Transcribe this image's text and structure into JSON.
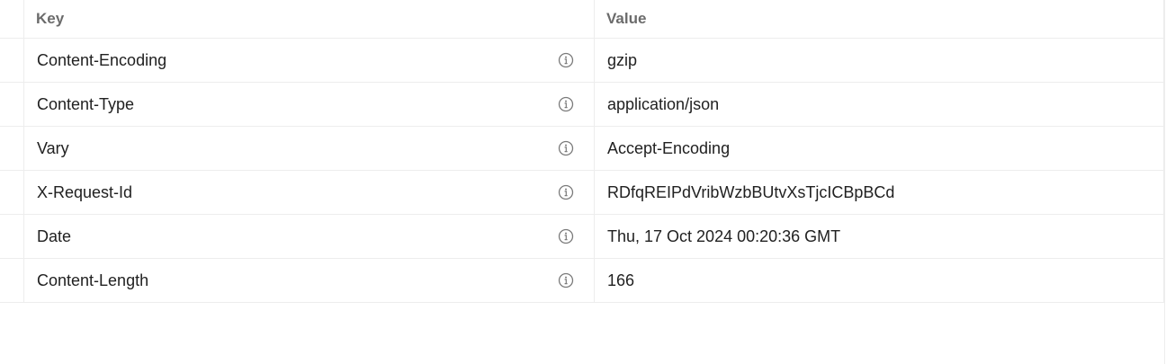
{
  "table": {
    "columns": {
      "key": "Key",
      "value": "Value"
    },
    "rows": [
      {
        "key": "Content-Encoding",
        "value": "gzip"
      },
      {
        "key": "Content-Type",
        "value": "application/json"
      },
      {
        "key": "Vary",
        "value": "Accept-Encoding"
      },
      {
        "key": "X-Request-Id",
        "value": "RDfqREIPdVribWzbBUtvXsTjcICBpBCd"
      },
      {
        "key": "Date",
        "value": "Thu, 17 Oct 2024 00:20:36 GMT"
      },
      {
        "key": "Content-Length",
        "value": "166"
      }
    ]
  },
  "icons": {
    "row_info": "info-circle-icon"
  },
  "colors": {
    "border": "#ededed",
    "header_text": "#6b6b6b",
    "body_text": "#212121",
    "icon": "#7a7a7a"
  }
}
